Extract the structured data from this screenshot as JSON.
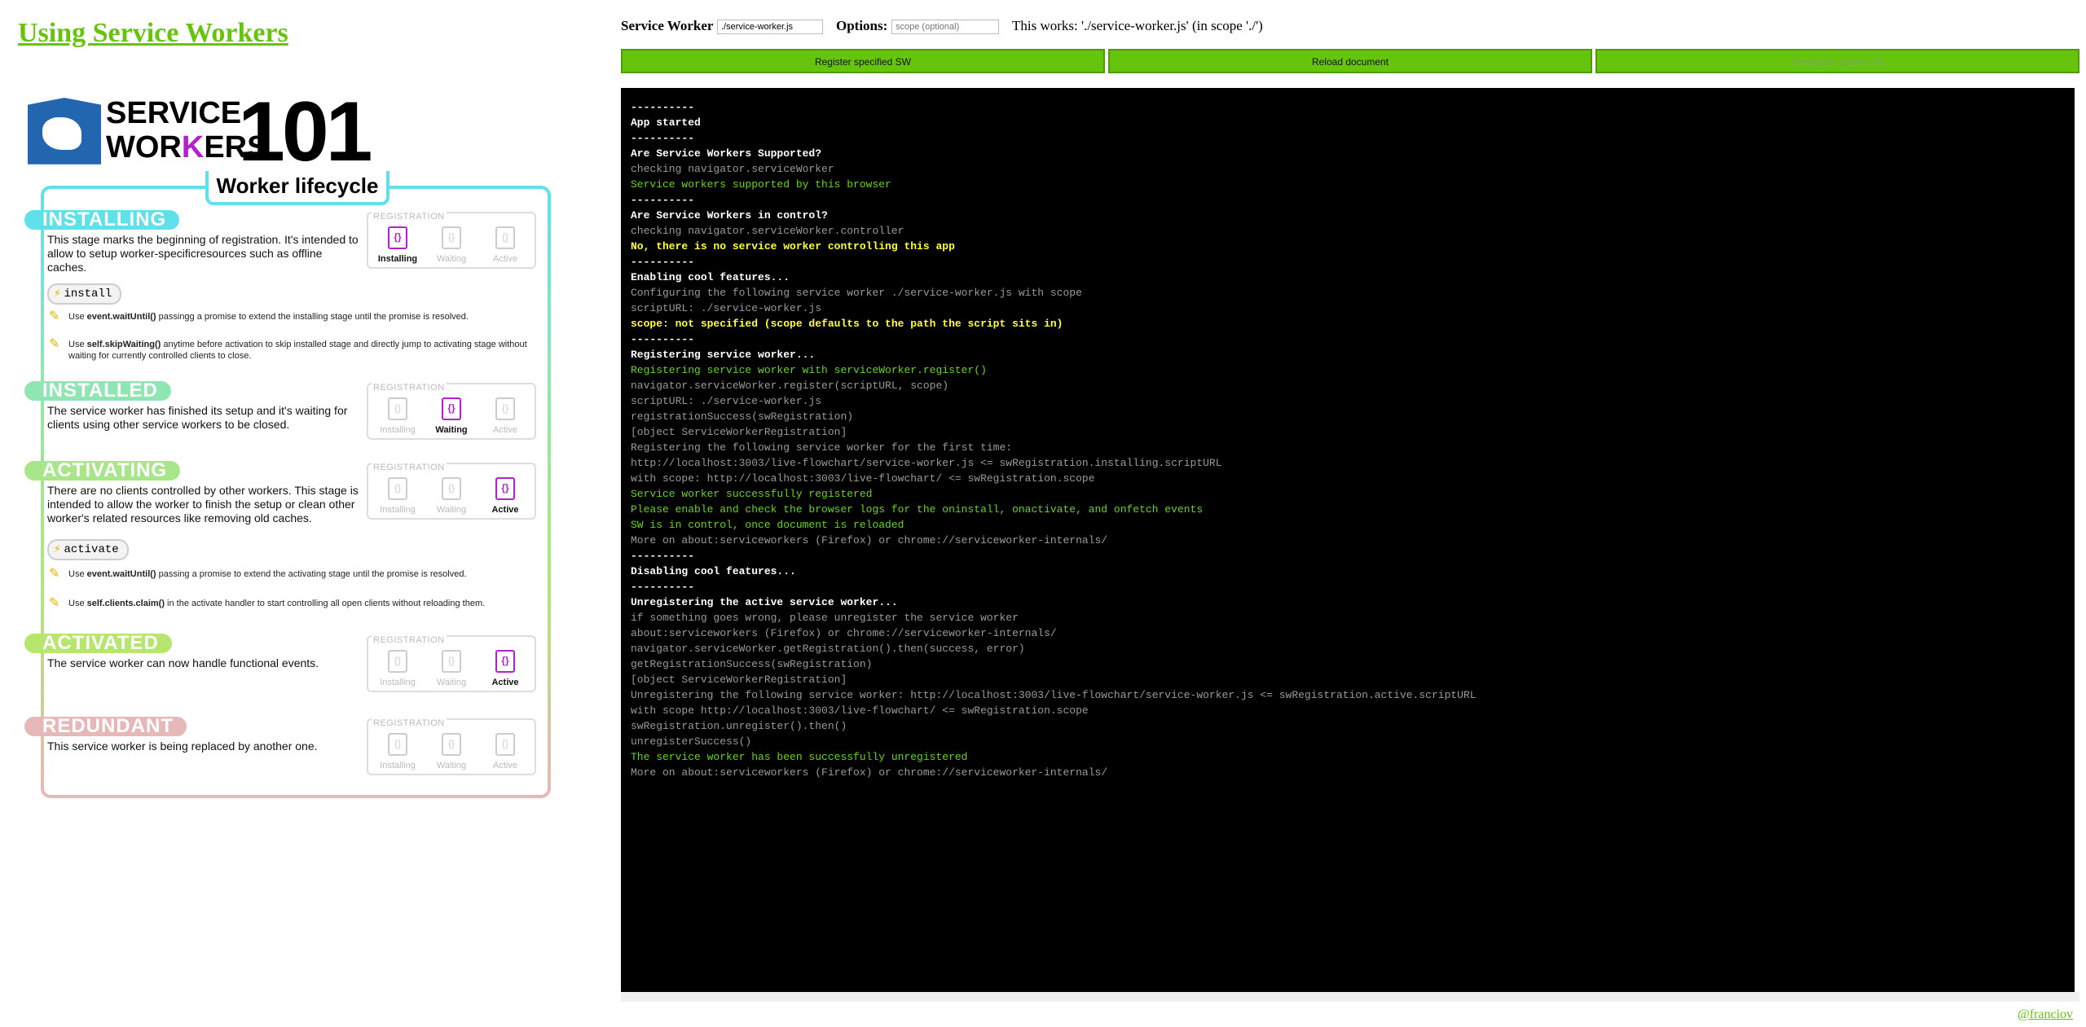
{
  "page_title": "Using Service Workers",
  "infographic": {
    "brand_line1": "SERVICE",
    "brand_line2_a": "WOR",
    "brand_line2_k": "K",
    "brand_line2_b": "ERS",
    "brand_number": "101",
    "subtitle": "Worker lifecycle",
    "registration_label": "REGISTRATION",
    "reg_states": [
      "Installing",
      "Waiting",
      "Active"
    ],
    "stages": [
      {
        "title": "INSTALLING",
        "color": "#5ee1e9",
        "desc": "This stage marks the beginning of registration. It's intended to allow to setup worker-specificresources such as offline caches.",
        "active_state": 0
      },
      {
        "title": "INSTALLED",
        "color": "#8fe6b2",
        "desc": "The service worker has finished its setup and it's waiting for clients using other service workers to be closed.",
        "active_state": 1
      },
      {
        "title": "ACTIVATING",
        "color": "#a9e68a",
        "desc": "There are no clients controlled by other workers. This stage is intended to allow the worker to finish the setup or clean other worker's related resources like removing old caches.",
        "active_state": 2
      },
      {
        "title": "ACTIVATED",
        "color": "#b6e66e",
        "desc": "The service worker can now handle functional events.",
        "active_state": 2
      },
      {
        "title": "REDUNDANT",
        "color": "#e6b8b8",
        "desc": "This service worker is being replaced by another one.",
        "active_state": -1
      }
    ],
    "events": [
      "install",
      "activate"
    ],
    "tips": [
      {
        "code": "event.waitUntil()",
        "pre": "Use ",
        "post": " passingg a promise to extend the installing stage until the promise is resolved."
      },
      {
        "code": "self.skipWaiting()",
        "pre": "Use ",
        "post": " anytime before activation to skip installed stage and directly jump to activating stage without waiting for currently controlled clients to close."
      },
      {
        "code": "event.waitUntil()",
        "pre": "Use ",
        "post": " passing a promise to extend the activating stage until the promise is resolved."
      },
      {
        "code": "self.clients.claim()",
        "pre": "Use ",
        "post": "  in the activate handler to start controlling all open clients without reloading them."
      }
    ]
  },
  "controls": {
    "sw_label": "Service Worker",
    "sw_value": "./service-worker.js",
    "options_label": "Options:",
    "options_placeholder": "scope (optional)",
    "works_text": "This works: './service-worker.js' (in scope './')",
    "register_button": "Register specified SW",
    "reload_button": "Reload document",
    "unregister_button": "Unregister active SW"
  },
  "console_lines": [
    {
      "t": "----------",
      "c": "white"
    },
    {
      "t": "App started",
      "c": "white"
    },
    {
      "t": "----------",
      "c": "white"
    },
    {
      "t": "Are Service Workers Supported?",
      "c": "white"
    },
    {
      "t": "checking navigator.serviceWorker",
      "c": "gray"
    },
    {
      "t": "Service workers supported by this browser",
      "c": "green"
    },
    {
      "t": "----------",
      "c": "white"
    },
    {
      "t": "Are Service Workers in control?",
      "c": "white"
    },
    {
      "t": "checking navigator.serviceWorker.controller",
      "c": "gray"
    },
    {
      "t": "No, there is no service worker controlling this app",
      "c": "yellow"
    },
    {
      "t": "----------",
      "c": "white"
    },
    {
      "t": "Enabling cool features...",
      "c": "white"
    },
    {
      "t": "Configuring the following service worker ./service-worker.js with scope",
      "c": "gray"
    },
    {
      "t": "scriptURL: ./service-worker.js",
      "c": "gray"
    },
    {
      "t": "scope: not specified (scope defaults to the path the script sits in)",
      "c": "yellow"
    },
    {
      "t": "----------",
      "c": "white"
    },
    {
      "t": "Registering service worker...",
      "c": "white"
    },
    {
      "t": "Registering service worker with serviceWorker.register()",
      "c": "green"
    },
    {
      "t": "navigator.serviceWorker.register(scriptURL, scope)",
      "c": "gray"
    },
    {
      "t": "scriptURL: ./service-worker.js",
      "c": "gray"
    },
    {
      "t": "registrationSuccess(swRegistration)",
      "c": "gray"
    },
    {
      "t": "[object ServiceWorkerRegistration]",
      "c": "gray"
    },
    {
      "t": "Registering the following service worker for the first time:",
      "c": "gray"
    },
    {
      "t": "http://localhost:3003/live-flowchart/service-worker.js <= swRegistration.installing.scriptURL",
      "c": "gray"
    },
    {
      "t": "with scope: http://localhost:3003/live-flowchart/ <= swRegistration.scope",
      "c": "gray"
    },
    {
      "t": "Service worker successfully registered",
      "c": "green"
    },
    {
      "t": "Please enable and check the browser logs for the oninstall, onactivate, and onfetch events",
      "c": "green"
    },
    {
      "t": "SW is in control, once document is reloaded",
      "c": "green"
    },
    {
      "t": "More on about:serviceworkers (Firefox) or chrome://serviceworker-internals/",
      "c": "gray"
    },
    {
      "t": "----------",
      "c": "white"
    },
    {
      "t": "Disabling cool features...",
      "c": "white"
    },
    {
      "t": "----------",
      "c": "white"
    },
    {
      "t": "Unregistering the active service worker...",
      "c": "white"
    },
    {
      "t": "if something goes wrong, please unregister the service worker",
      "c": "gray"
    },
    {
      "t": "about:serviceworkers (Firefox) or chrome://serviceworker-internals/",
      "c": "gray"
    },
    {
      "t": "navigator.serviceWorker.getRegistration().then(success, error)",
      "c": "gray"
    },
    {
      "t": "getRegistrationSuccess(swRegistration)",
      "c": "gray"
    },
    {
      "t": "[object ServiceWorkerRegistration]",
      "c": "gray"
    },
    {
      "t": "Unregistering the following service worker: http://localhost:3003/live-flowchart/service-worker.js <= swRegistration.active.scriptURL",
      "c": "gray"
    },
    {
      "t": "with scope http://localhost:3003/live-flowchart/ <= swRegistration.scope",
      "c": "gray"
    },
    {
      "t": "swRegistration.unregister().then()",
      "c": "gray"
    },
    {
      "t": "unregisterSuccess()",
      "c": "gray"
    },
    {
      "t": "The service worker has been successfully unregistered",
      "c": "green"
    },
    {
      "t": "More on about:serviceworkers (Firefox) or chrome://serviceworker-internals/",
      "c": "gray"
    }
  ],
  "credit": "@franciov"
}
